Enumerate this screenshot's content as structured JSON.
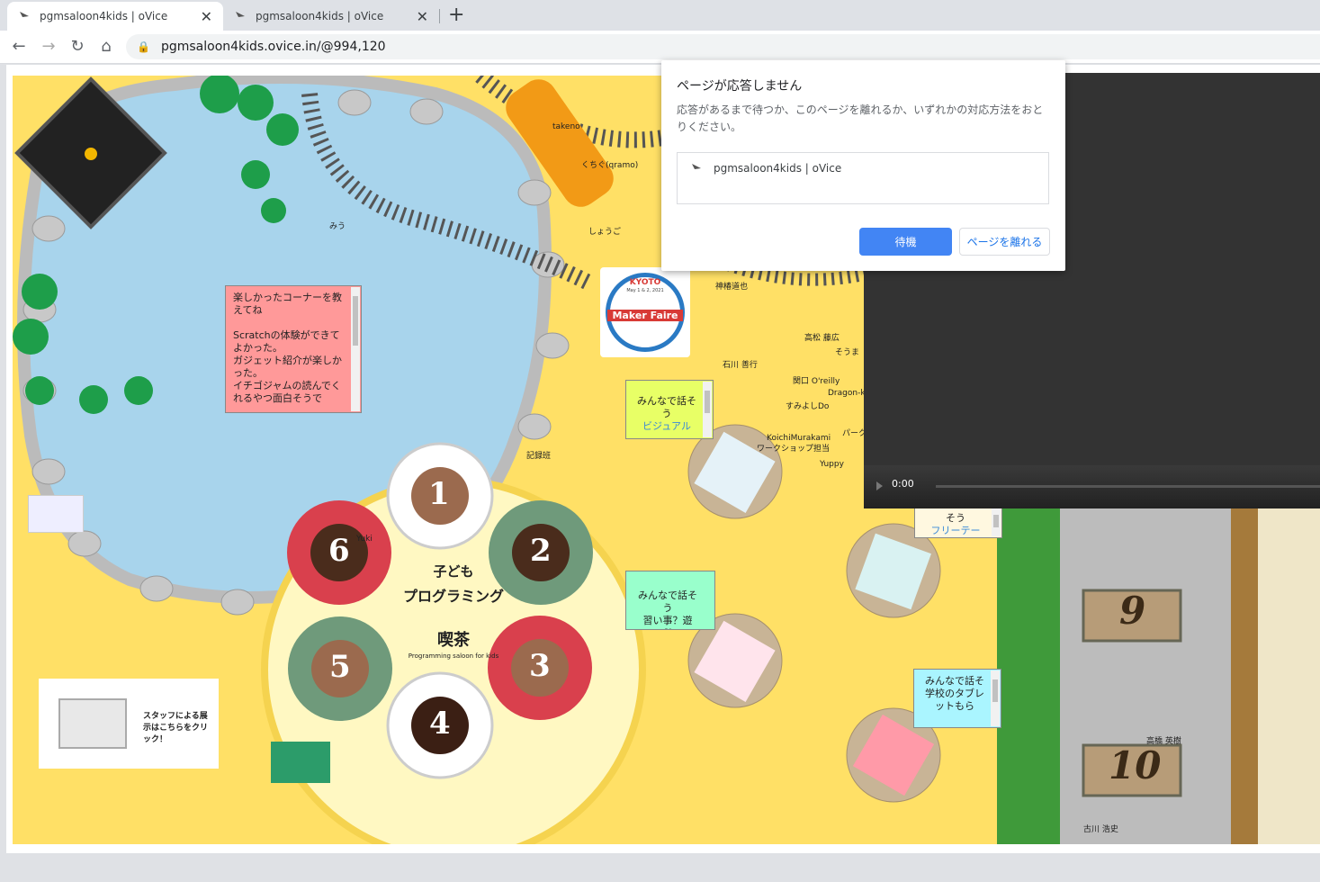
{
  "browser": {
    "tabs": [
      {
        "title": "pgmsaloon4kids | oVice",
        "active": true
      },
      {
        "title": "pgmsaloon4kids | oVice",
        "active": false
      }
    ],
    "url": "pgmsaloon4kids.ovice.in/@994,120"
  },
  "app": {
    "logo": "oVice",
    "cafe_sign": {
      "line1": "子ども",
      "line2": "プログラミング",
      "line3": "喫茶",
      "sub": "Programming saloon for kids"
    },
    "cups": [
      "1",
      "2",
      "3",
      "4",
      "5",
      "6"
    ],
    "table_numbers": [
      "9",
      "10"
    ],
    "maker_faire": {
      "top": "KYOTO",
      "date": "May 1 & 2, 2021",
      "name": "Maker Faire"
    },
    "staff_banner": "スタッフによる展示はこちらをクリック！",
    "notes": [
      {
        "id": "feedback",
        "text": "楽しかったコーナーを教えてね\n\nScratchの体験ができてよかった。\nガジェット紹介が楽しかった。\nイチゴジャムの読んでくれるやつ面白そうで",
        "color": "#ff9999"
      },
      {
        "id": "talk-visual",
        "text": "みんなで話そう",
        "link": "ビジュアル",
        "color": "#e8ff66"
      },
      {
        "id": "talk-lessons",
        "text": "みんなで話そう\n習い事？遊び？",
        "color": "#99ffcc"
      },
      {
        "id": "talk-free",
        "text": "そう",
        "link": "フリーテー",
        "color": "#fff8e0"
      },
      {
        "id": "talk-tablet",
        "text": "みんなで話そ\n学校のタブレットもら",
        "color": "#aaf5ff"
      }
    ],
    "avatars": [
      {
        "name": "takeno"
      },
      {
        "name": "くちぐ(qramo)"
      },
      {
        "name": "しょうご"
      },
      {
        "name": "みう"
      },
      {
        "name": "神椿道也"
      },
      {
        "name": "高松 藤広"
      },
      {
        "name": "そうま"
      },
      {
        "name": "石川 善行"
      },
      {
        "name": "関口 O'reilly"
      },
      {
        "name": "すみよしDo"
      },
      {
        "name": "Dragon-k"
      },
      {
        "name": "KoichiMurakami"
      },
      {
        "name": "ワークショップ担当"
      },
      {
        "name": "Yuppy"
      },
      {
        "name": "記録班"
      },
      {
        "name": "パーク"
      },
      {
        "name": "Yuki"
      },
      {
        "name": "高橋 英樹"
      },
      {
        "name": "古川 浩史"
      }
    ]
  },
  "dialog": {
    "title": "ページが応答しません",
    "message": "応答があるまで待つか、このページを離れるか、いずれかの対応方法をおとりください。",
    "page_item": "pgmsaloon4kids | oVice",
    "wait_label": "待機",
    "leave_label": "ページを離れる"
  },
  "video": {
    "time": "0:00"
  },
  "colors": {
    "floor": "#ffe066",
    "water": "#a8d4ec",
    "accent_blue": "#4285f4"
  }
}
